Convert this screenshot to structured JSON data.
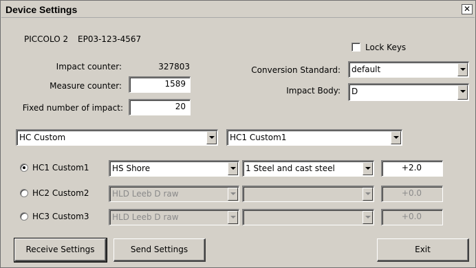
{
  "window": {
    "title": "Device Settings",
    "close_glyph": "✕"
  },
  "device": {
    "model": "PICCOLO 2",
    "serial": "EP03-123-4567"
  },
  "counters": {
    "impact_label": "Impact counter:",
    "impact_value": "327803",
    "measure_label": "Measure counter:",
    "measure_value": "1589",
    "fixed_label": "Fixed number of impact:",
    "fixed_value": "20"
  },
  "options": {
    "lock_keys_label": "Lock Keys",
    "lock_keys_checked": false,
    "conversion_label": "Conversion Standard:",
    "conversion_value": "default",
    "impact_body_label": "Impact Body:",
    "impact_body_value": "D"
  },
  "hardness": {
    "scale_value": "HC  Custom",
    "custom_value": "HC1  Custom1"
  },
  "customs": [
    {
      "label": "HC1 Custom1",
      "selected": true,
      "scale": "HS   Shore",
      "material": "1 Steel and cast steel",
      "offset": "+2.0",
      "enabled": true
    },
    {
      "label": "HC2 Custom2",
      "selected": false,
      "scale": "HLD Leeb D raw",
      "material": "",
      "offset": "+0.0",
      "enabled": false
    },
    {
      "label": "HC3 Custom3",
      "selected": false,
      "scale": "HLD Leeb D raw",
      "material": "",
      "offset": "+0.0",
      "enabled": false
    }
  ],
  "buttons": {
    "receive": "Receive Settings",
    "send": "Send Settings",
    "exit": "Exit"
  }
}
